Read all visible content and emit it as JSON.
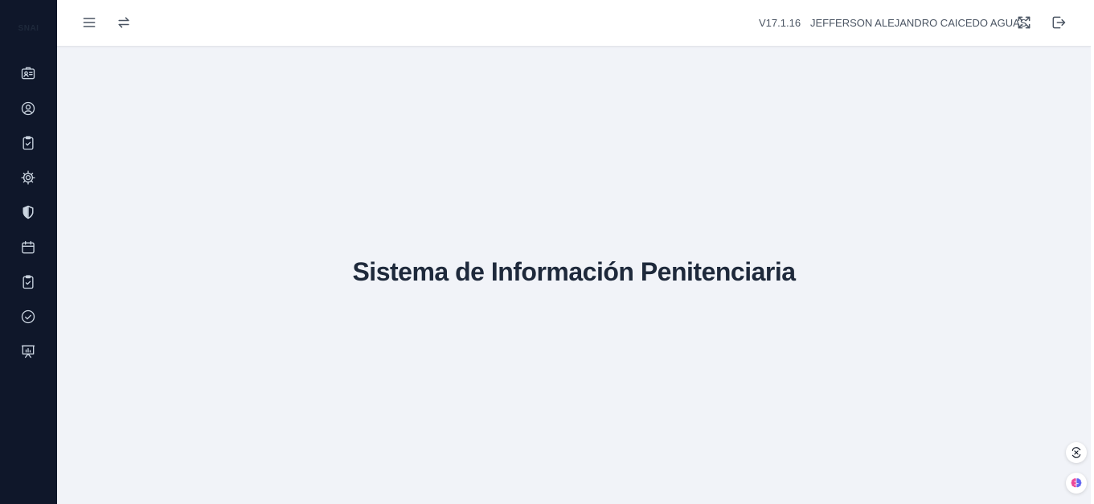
{
  "sidebar": {
    "logo_text": "SNAI",
    "items": [
      {
        "icon": "id-card-icon"
      },
      {
        "icon": "user-circle-icon"
      },
      {
        "icon": "clipboard-check-icon"
      },
      {
        "icon": "gear-icon"
      },
      {
        "icon": "shield-icon"
      },
      {
        "icon": "calendar-icon"
      },
      {
        "icon": "clipboard-check-icon"
      },
      {
        "icon": "check-circle-icon"
      },
      {
        "icon": "presentation-chart-icon"
      }
    ]
  },
  "header": {
    "menu_icon": "hamburger-menu-icon",
    "swap_icon": "swap-arrows-icon",
    "version": "V17.1.16",
    "user_name": "JEFFERSON ALEJANDRO CAICEDO AGUAS",
    "fullscreen_icon": "fullscreen-icon",
    "logout_icon": "logout-icon"
  },
  "main": {
    "title": "Sistema de Información Penitenciaria"
  },
  "floating": {
    "top_icon": "translate-icon",
    "bottom_icon": "brain-icon"
  },
  "colors": {
    "sidebar_bg": "#0f172a",
    "content_bg": "#f1f3f8",
    "title": "#1e293b"
  }
}
